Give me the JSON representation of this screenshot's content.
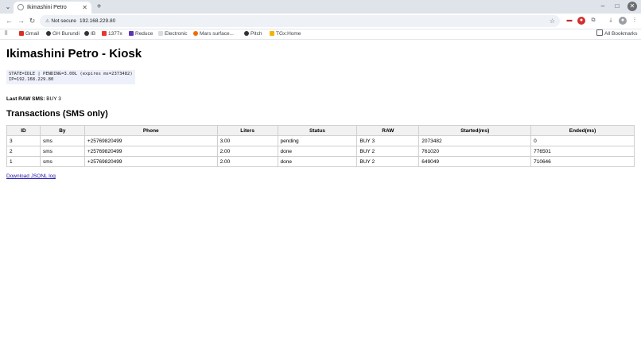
{
  "browser": {
    "tab_title": "Ikimashini Petro",
    "security_label": "Not secure",
    "url": "192.168.229.80",
    "bookmarks": [
      {
        "label": "Gmail",
        "color": "#d93025"
      },
      {
        "label": "GH Burundi",
        "color": "#333333"
      },
      {
        "label": "IB",
        "color": "#333333"
      },
      {
        "label": "1377x",
        "color": "#e53935"
      },
      {
        "label": "Reduce",
        "color": "#5e35b1"
      },
      {
        "label": "Electronic",
        "color": "#9e9e9e"
      },
      {
        "label": "Mars surface...",
        "color": "#ef6c00"
      },
      {
        "label": "Pitch",
        "color": "#333333"
      },
      {
        "label": "TGx:Home",
        "color": "#f4b400"
      }
    ],
    "all_bookmarks_label": "All Bookmarks"
  },
  "page": {
    "title": "Ikimashini Petro - Kiosk",
    "state_line1": "STATE=IDLE | PENDING=3.00L (expires ms=2373482)",
    "state_line2": "IP=192.168.229.80",
    "last_raw_label": "Last RAW SMS:",
    "last_raw_value": "BUY 3",
    "transactions_title": "Transactions (SMS only)",
    "columns": [
      "ID",
      "By",
      "Phone",
      "Liters",
      "Status",
      "RAW",
      "Started(ms)",
      "Ended(ms)"
    ],
    "rows": [
      [
        "3",
        "sms",
        "+25769820499",
        "3.00",
        "pending",
        "BUY 3",
        "2073482",
        "0"
      ],
      [
        "2",
        "sms",
        "+25769820499",
        "2.00",
        "done",
        "BUY 2",
        "761020",
        "776501"
      ],
      [
        "1",
        "sms",
        "+25769820499",
        "2.00",
        "done",
        "BUY 2",
        "649049",
        "710646"
      ]
    ],
    "download_label": "Download JSONL log"
  }
}
